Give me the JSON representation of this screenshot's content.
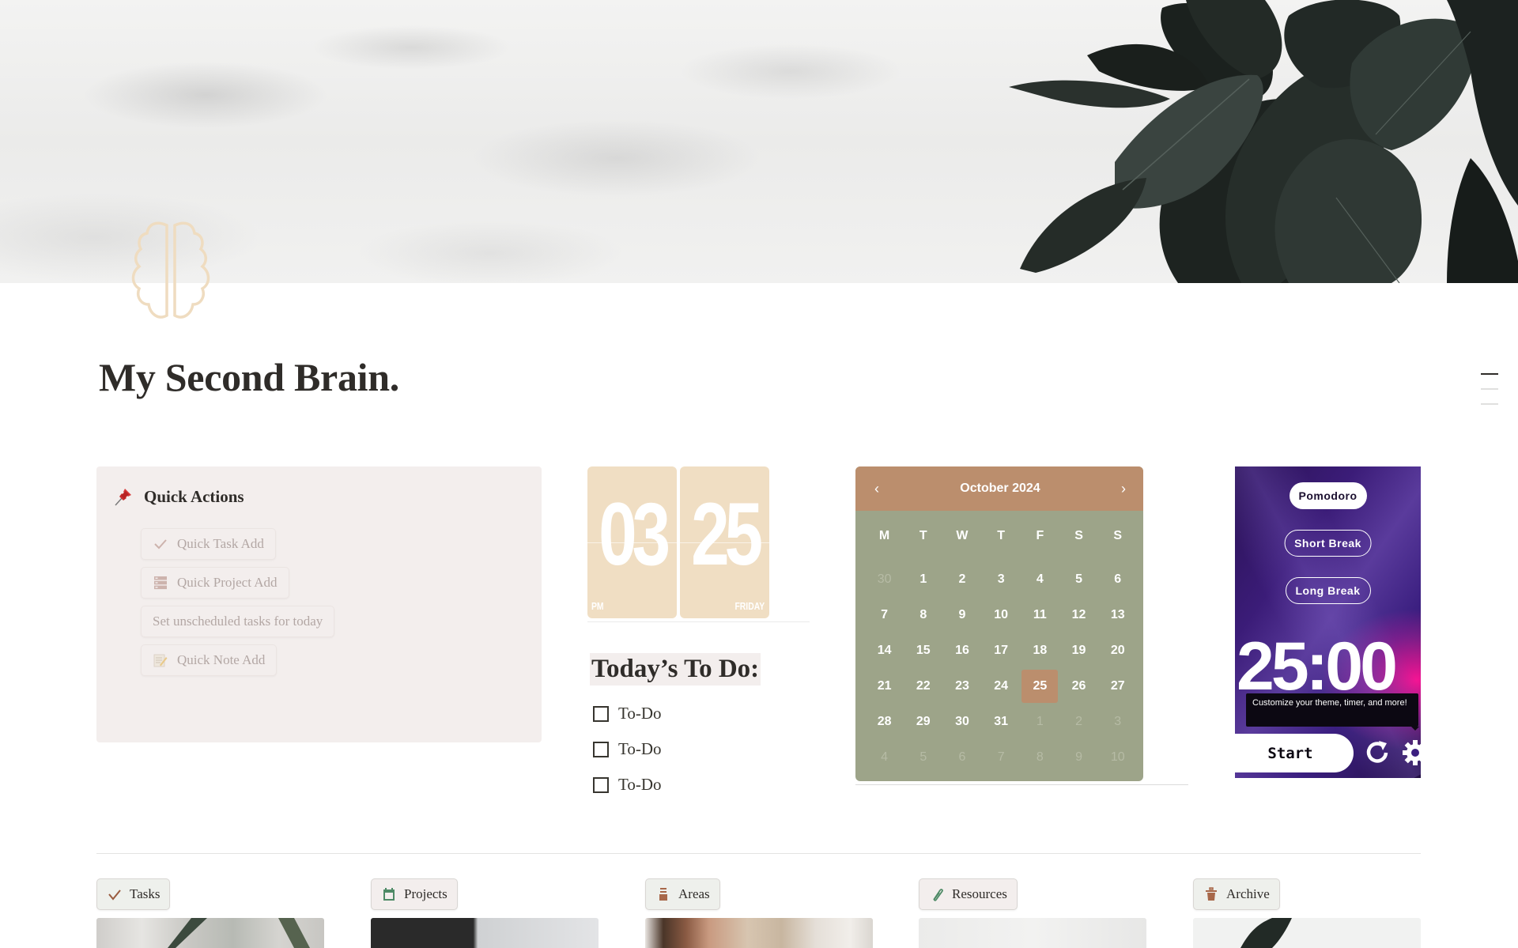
{
  "page": {
    "title": "My Second Brain.",
    "icon": "brain-outline-icon",
    "cover": "marble-and-rubber-plant-image"
  },
  "quick_actions": {
    "title": "Quick Actions",
    "icon": "pushpin-icon",
    "buttons": [
      {
        "label": "Quick Task Add",
        "icon": "checkmark-icon"
      },
      {
        "label": "Quick Project Add",
        "icon": "stacked-database-icon"
      },
      {
        "label": "Set unscheduled tasks for today",
        "icon": ""
      },
      {
        "label": "Quick Note Add",
        "icon": "memo-pencil-icon"
      }
    ]
  },
  "clock": {
    "hour": "03",
    "minute": "25",
    "period": "PM",
    "weekday": "FRIDAY",
    "card_color": "#f0dec3"
  },
  "todo": {
    "title": "Today’s To Do:",
    "items": [
      {
        "label": "To-Do",
        "checked": false
      },
      {
        "label": "To-Do",
        "checked": false
      },
      {
        "label": "To-Do",
        "checked": false
      }
    ]
  },
  "calendar": {
    "month_label": "October 2024",
    "prev_label": "‹",
    "next_label": "›",
    "weekdays": [
      "M",
      "T",
      "W",
      "T",
      "F",
      "S",
      "S"
    ],
    "days": [
      {
        "d": "30",
        "other": true
      },
      {
        "d": "1"
      },
      {
        "d": "2"
      },
      {
        "d": "3"
      },
      {
        "d": "4"
      },
      {
        "d": "5"
      },
      {
        "d": "6"
      },
      {
        "d": "7"
      },
      {
        "d": "8"
      },
      {
        "d": "9"
      },
      {
        "d": "10"
      },
      {
        "d": "11"
      },
      {
        "d": "12"
      },
      {
        "d": "13"
      },
      {
        "d": "14"
      },
      {
        "d": "15"
      },
      {
        "d": "16"
      },
      {
        "d": "17"
      },
      {
        "d": "18"
      },
      {
        "d": "19"
      },
      {
        "d": "20"
      },
      {
        "d": "21"
      },
      {
        "d": "22"
      },
      {
        "d": "23"
      },
      {
        "d": "24"
      },
      {
        "d": "25",
        "today": true
      },
      {
        "d": "26"
      },
      {
        "d": "27"
      },
      {
        "d": "28"
      },
      {
        "d": "29"
      },
      {
        "d": "30"
      },
      {
        "d": "31"
      },
      {
        "d": "1",
        "other": true
      },
      {
        "d": "2",
        "other": true
      },
      {
        "d": "3",
        "other": true
      },
      {
        "d": "4",
        "other": true
      },
      {
        "d": "5",
        "other": true
      },
      {
        "d": "6",
        "other": true
      },
      {
        "d": "7",
        "other": true
      },
      {
        "d": "8",
        "other": true
      },
      {
        "d": "9",
        "other": true
      },
      {
        "d": "10",
        "other": true
      }
    ],
    "header_color": "#bb8e6d",
    "body_color": "#9da489"
  },
  "pomodoro": {
    "modes": [
      "Pomodoro",
      "Short Break",
      "Long Break"
    ],
    "active_mode": "Pomodoro",
    "time": "25:00",
    "tooltip": "Customize your theme, timer, and more!",
    "start_label": "Start",
    "reset_icon": "reset-icon",
    "settings_icon": "gear-icon"
  },
  "nav": [
    {
      "label": "Tasks",
      "icon": "checkmark-icon",
      "icon_color": "#9a5b3f",
      "style": "green"
    },
    {
      "label": "Projects",
      "icon": "calendar-icon",
      "icon_color": "#4e8a66",
      "style": "pink"
    },
    {
      "label": "Areas",
      "icon": "filing-cabinet-icon",
      "icon_color": "#a8684a",
      "style": "green"
    },
    {
      "label": "Resources",
      "icon": "paperclip-icon",
      "icon_color": "#4e8a66",
      "style": "pink"
    },
    {
      "label": "Archive",
      "icon": "trash-bin-icon",
      "icon_color": "#a8684a",
      "style": "green"
    }
  ]
}
